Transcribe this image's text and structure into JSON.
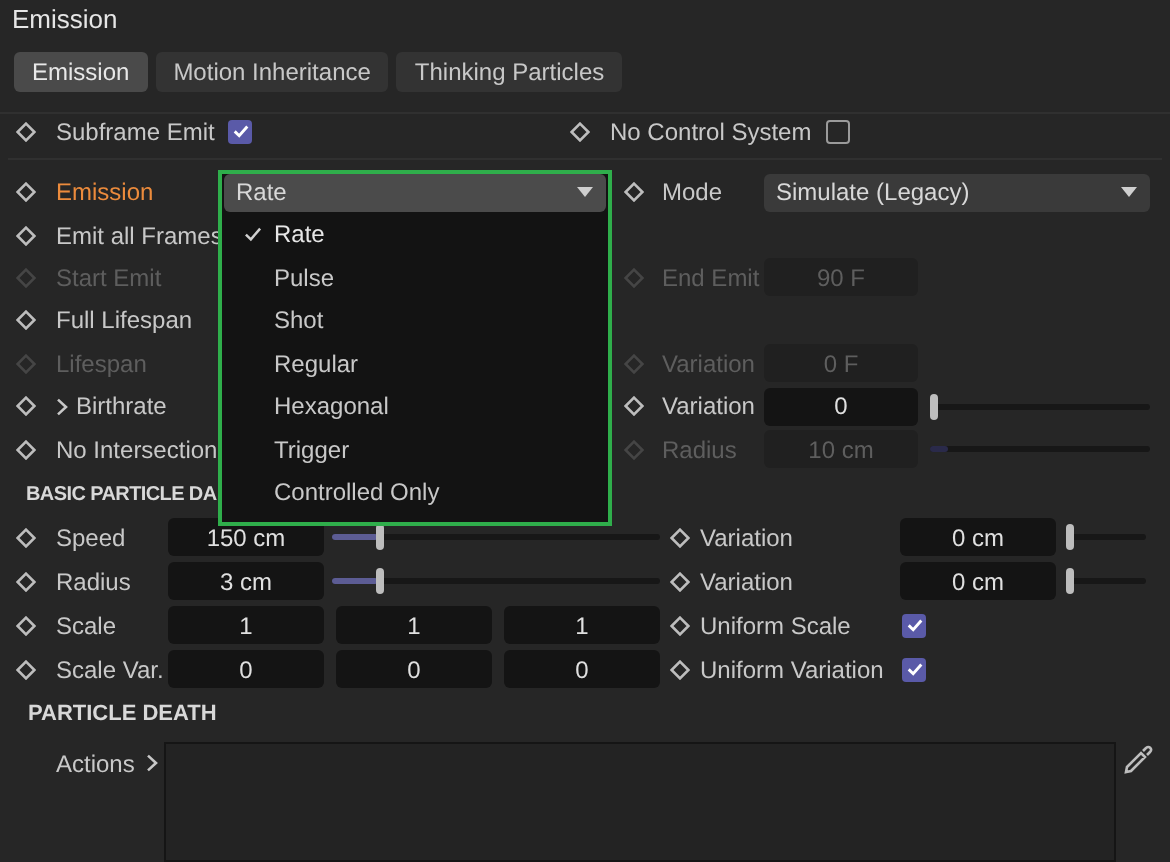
{
  "panel_title": "Emission",
  "tabs": [
    {
      "label": "Emission",
      "selected": true
    },
    {
      "label": "Motion Inheritance",
      "selected": false
    },
    {
      "label": "Thinking Particles",
      "selected": false
    }
  ],
  "subframe_row": [
    {
      "kind": "checkbox",
      "label": "Subframe Emit",
      "checked": true
    },
    {
      "kind": "checkbox",
      "label": "No Control System",
      "checked": false
    }
  ],
  "emission_rows": [
    {
      "left": {
        "kind": "dropdown",
        "label": "Emission",
        "highlighted": true,
        "disabled": false,
        "value": "Rate",
        "open": true
      },
      "right": {
        "kind": "dropdown",
        "label": "Mode",
        "disabled": false,
        "value": "Simulate (Legacy)",
        "open": false
      }
    },
    {
      "left": {
        "kind": "label",
        "label": "Emit all Frames",
        "highlighted": false,
        "disabled": false
      }
    },
    {
      "left": {
        "kind": "label",
        "label": "Start Emit",
        "highlighted": false,
        "disabled": true
      },
      "right": {
        "kind": "field",
        "label": "End Emit",
        "disabled": true,
        "value": "90 F"
      }
    },
    {
      "left": {
        "kind": "label",
        "label": "Full Lifespan",
        "highlighted": false,
        "disabled": false
      }
    },
    {
      "left": {
        "kind": "label",
        "label": "Lifespan",
        "highlighted": false,
        "disabled": true
      },
      "right": {
        "kind": "field",
        "label": "Variation",
        "disabled": true,
        "value": "0 F"
      }
    },
    {
      "left": {
        "kind": "expander",
        "label": "Birthrate",
        "highlighted": false,
        "disabled": false,
        "expanded": false
      },
      "right": {
        "kind": "slider",
        "label": "Variation",
        "disabled": false,
        "value": "0",
        "level": 0
      }
    },
    {
      "left": {
        "kind": "label",
        "label": "No Intersection",
        "highlighted": false,
        "disabled": false
      },
      "right": {
        "kind": "slider",
        "label": "Radius",
        "disabled": true,
        "value": "10 cm",
        "level": 0.08
      }
    }
  ],
  "emission_menu": [
    {
      "label": "Rate",
      "selected": true
    },
    {
      "label": "Pulse",
      "selected": false
    },
    {
      "label": "Shot",
      "selected": false
    },
    {
      "label": "Regular",
      "selected": false
    },
    {
      "label": "Hexagonal",
      "selected": false
    },
    {
      "label": "Trigger",
      "selected": false
    },
    {
      "label": "Controlled Only",
      "selected": false
    }
  ],
  "basic_section": {
    "title": "BASIC PARTICLE DA",
    "rows": [
      {
        "left": {
          "kind": "slider",
          "label": "Speed",
          "value": "150 cm",
          "level": 0.14
        },
        "right": {
          "kind": "slider",
          "label": "Variation",
          "value": "0 cm",
          "level": 0
        }
      },
      {
        "left": {
          "kind": "slider",
          "label": "Radius",
          "value": "3 cm",
          "level": 0.14
        },
        "right": {
          "kind": "slider",
          "label": "Variation",
          "value": "0 cm",
          "level": 0
        }
      },
      {
        "left": {
          "kind": "vector",
          "label": "Scale",
          "values": [
            "1",
            "1",
            "1"
          ]
        },
        "right": {
          "kind": "checkbox",
          "label": "Uniform Scale",
          "checked": true
        }
      },
      {
        "left": {
          "kind": "vector",
          "label": "Scale Var.",
          "values": [
            "0",
            "0",
            "0"
          ]
        },
        "right": {
          "kind": "checkbox",
          "label": "Uniform Variation",
          "checked": true
        }
      }
    ]
  },
  "death_section": {
    "title": "PARTICLE DEATH",
    "actions_label": "Actions",
    "actions_expanded": false
  }
}
